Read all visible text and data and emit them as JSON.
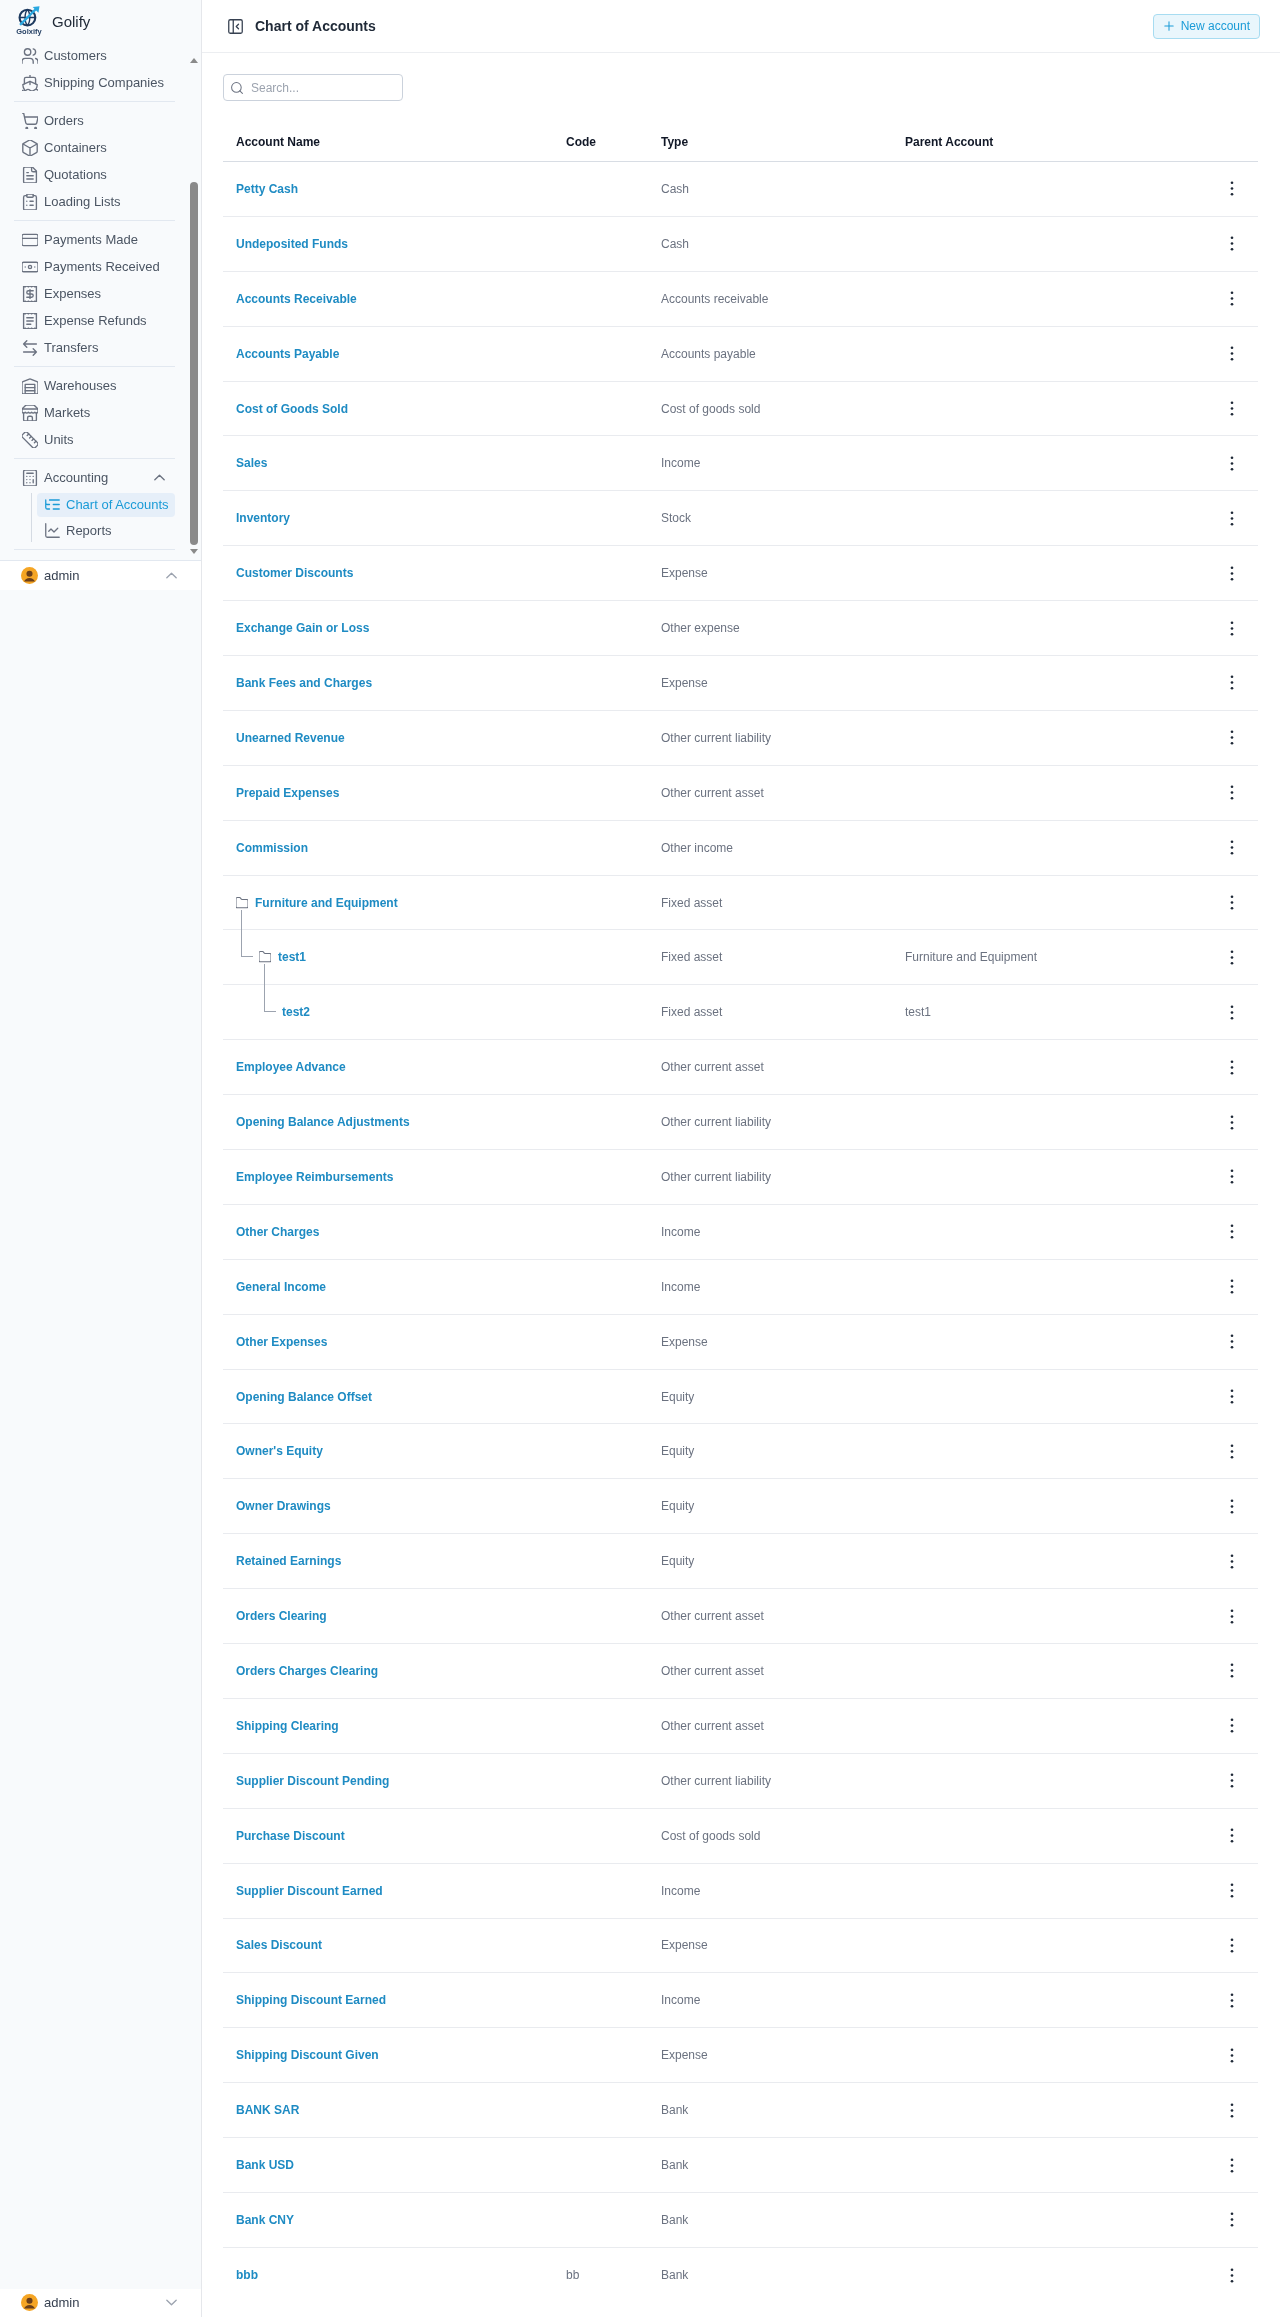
{
  "sidebar": {
    "brand": {
      "name": "Golify",
      "logo_text": "Golxify"
    },
    "nav_groups": [
      {
        "items": [
          {
            "label": "Customers",
            "selected": false
          },
          {
            "label": "Shipping Companies",
            "selected": false
          }
        ]
      },
      {
        "items": [
          {
            "label": "Orders",
            "selected": false
          },
          {
            "label": "Containers",
            "selected": false
          },
          {
            "label": "Quotations",
            "selected": false
          },
          {
            "label": "Loading Lists",
            "selected": false
          }
        ]
      },
      {
        "items": [
          {
            "label": "Payments Made",
            "selected": false
          },
          {
            "label": "Payments Received",
            "selected": false
          },
          {
            "label": "Expenses",
            "selected": false
          },
          {
            "label": "Expense Refunds",
            "selected": false
          },
          {
            "label": "Transfers",
            "selected": false
          }
        ]
      },
      {
        "items": [
          {
            "label": "Warehouses",
            "selected": false
          },
          {
            "label": "Markets",
            "selected": false
          },
          {
            "label": "Units",
            "selected": false
          }
        ]
      },
      {
        "items": [
          {
            "label": "Accounting",
            "selected": false,
            "expanded": true,
            "children": [
              {
                "label": "Chart of Accounts",
                "selected": true
              },
              {
                "label": "Reports",
                "selected": false
              }
            ]
          }
        ]
      }
    ],
    "user": {
      "name": "admin",
      "expanded": true
    }
  },
  "sidebar_footer": {
    "user": {
      "name": "admin",
      "expanded": false
    }
  },
  "header": {
    "title": "Chart of Accounts",
    "new_button": "New account"
  },
  "search": {
    "placeholder": "Search..."
  },
  "table": {
    "columns": [
      "Account Name",
      "Code",
      "Type",
      "Parent Account"
    ],
    "rows": [
      {
        "name": "Petty Cash",
        "type": "Cash"
      },
      {
        "name": "Undeposited Funds",
        "type": "Cash"
      },
      {
        "name": "Accounts Receivable",
        "type": "Accounts receivable"
      },
      {
        "name": "Accounts Payable",
        "type": "Accounts payable"
      },
      {
        "name": "Cost of Goods Sold",
        "type": "Cost of goods sold"
      },
      {
        "name": "Sales",
        "type": "Income"
      },
      {
        "name": "Inventory",
        "type": "Stock"
      },
      {
        "name": "Customer Discounts",
        "type": "Expense"
      },
      {
        "name": "Exchange Gain or Loss",
        "type": "Other expense"
      },
      {
        "name": "Bank Fees and Charges",
        "type": "Expense"
      },
      {
        "name": "Unearned Revenue",
        "type": "Other current liability"
      },
      {
        "name": "Prepaid Expenses",
        "type": "Other current asset"
      },
      {
        "name": "Commission",
        "type": "Other income"
      },
      {
        "name": "Furniture and Equipment",
        "type": "Fixed asset",
        "children": [
          {
            "name": "test1",
            "type": "Fixed asset",
            "parent_account": "Furniture and Equipment",
            "children": [
              {
                "name": "test2",
                "type": "Fixed asset",
                "parent_account": "test1"
              }
            ]
          }
        ]
      },
      {
        "name": "Employee Advance",
        "type": "Other current asset"
      },
      {
        "name": "Opening Balance Adjustments",
        "type": "Other current liability"
      },
      {
        "name": "Employee Reimbursements",
        "type": "Other current liability"
      },
      {
        "name": "Other Charges",
        "type": "Income"
      },
      {
        "name": "General Income",
        "type": "Income"
      },
      {
        "name": "Other Expenses",
        "type": "Expense"
      },
      {
        "name": "Opening Balance Offset",
        "type": "Equity"
      },
      {
        "name": "Owner's Equity",
        "type": "Equity"
      },
      {
        "name": "Owner Drawings",
        "type": "Equity"
      },
      {
        "name": "Retained Earnings",
        "type": "Equity"
      },
      {
        "name": "Orders Clearing",
        "type": "Other current asset"
      },
      {
        "name": "Orders Charges Clearing",
        "type": "Other current asset"
      },
      {
        "name": "Shipping Clearing",
        "type": "Other current asset"
      },
      {
        "name": "Supplier Discount Pending",
        "type": "Other current liability"
      },
      {
        "name": "Purchase Discount",
        "type": "Cost of goods sold"
      },
      {
        "name": "Supplier Discount Earned",
        "type": "Income"
      },
      {
        "name": "Sales Discount",
        "type": "Expense"
      },
      {
        "name": "Shipping Discount Earned",
        "type": "Income"
      },
      {
        "name": "Shipping Discount Given",
        "type": "Expense"
      },
      {
        "name": "BANK SAR",
        "type": "Bank"
      },
      {
        "name": "Bank USD",
        "type": "Bank"
      },
      {
        "name": "Bank CNY",
        "type": "Bank"
      },
      {
        "name": "bbb",
        "code": "bb",
        "type": "Bank"
      }
    ]
  }
}
